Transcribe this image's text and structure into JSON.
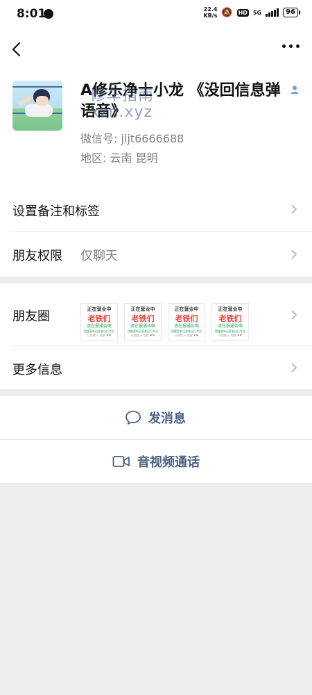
{
  "status_bar": {
    "time": "8:01",
    "speed_value": "22.4",
    "speed_unit": "KB/s",
    "hd": "HD",
    "network": "5G",
    "battery": "96"
  },
  "profile": {
    "name": "A修乐净士小龙 《没回信息弹语音》",
    "watermark_line1": "修车指南",
    "watermark_line2": "xzn.xyz",
    "wechat_id": "微信号:  jljt6666688",
    "region": "地区:  云南  昆明"
  },
  "rows": {
    "remark": "设置备注和标签",
    "permission_label": "朋友权限",
    "permission_value": "仅聊天",
    "moments_label": "朋友圈",
    "more_info": "更多信息"
  },
  "moments_thumb": {
    "line1": "正在营业中",
    "line2": "老铁们",
    "line3": "请在报通告啊",
    "line4": "提醒更新运营者运行专业",
    "line5": "已领取 ◎ 领取 ♥♥"
  },
  "actions": {
    "message": "发消息",
    "call": "音视频通话"
  },
  "colors": {
    "link": "#4a5f84",
    "thumb_red": "#e8423a",
    "thumb_green": "#27a85f"
  }
}
